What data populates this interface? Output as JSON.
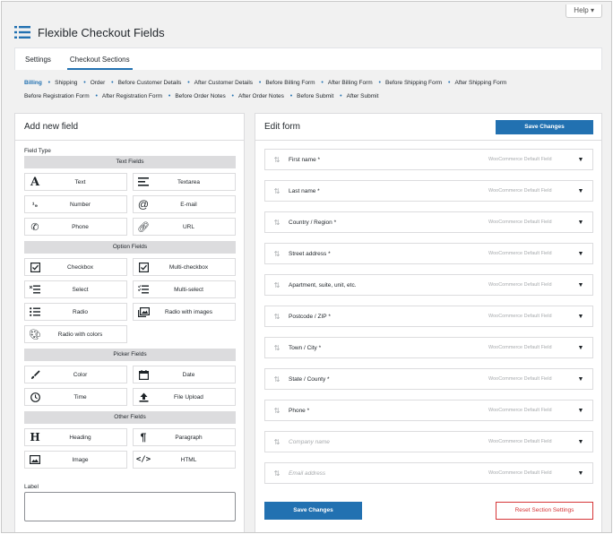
{
  "header": {
    "help_label": "Help ▾",
    "title": "Flexible Checkout Fields"
  },
  "tabs": [
    {
      "label": "Settings",
      "active": false
    },
    {
      "label": "Checkout Sections",
      "active": true
    }
  ],
  "sections": [
    "Billing",
    "Shipping",
    "Order",
    "Before Customer Details",
    "After Customer Details",
    "Before Billing Form",
    "After Billing Form",
    "Before Shipping Form",
    "After Shipping Form",
    "Before Registration Form",
    "After Registration Form",
    "Before Order Notes",
    "After Order Notes",
    "Before Submit",
    "After Submit"
  ],
  "add_field": {
    "title": "Add new field",
    "field_type_label": "Field Type",
    "groups": [
      {
        "name": "Text Fields",
        "fields": [
          {
            "label": "Text",
            "icon": "text-icon"
          },
          {
            "label": "Textarea",
            "icon": "textarea-icon"
          },
          {
            "label": "Number",
            "icon": "number-icon"
          },
          {
            "label": "E-mail",
            "icon": "email-icon"
          },
          {
            "label": "Phone",
            "icon": "phone-icon"
          },
          {
            "label": "URL",
            "icon": "link-icon"
          }
        ]
      },
      {
        "name": "Option Fields",
        "fields": [
          {
            "label": "Checkbox",
            "icon": "checkbox-icon"
          },
          {
            "label": "Multi-checkbox",
            "icon": "multi-checkbox-icon"
          },
          {
            "label": "Select",
            "icon": "select-icon"
          },
          {
            "label": "Multi-select",
            "icon": "multi-select-icon"
          },
          {
            "label": "Radio",
            "icon": "radio-icon"
          },
          {
            "label": "Radio with images",
            "icon": "image-radio-icon"
          },
          {
            "label": "Radio with colors",
            "icon": "palette-icon"
          }
        ]
      },
      {
        "name": "Picker Fields",
        "fields": [
          {
            "label": "Color",
            "icon": "brush-icon"
          },
          {
            "label": "Date",
            "icon": "calendar-icon"
          },
          {
            "label": "Time",
            "icon": "clock-icon"
          },
          {
            "label": "File Upload",
            "icon": "upload-icon"
          }
        ]
      },
      {
        "name": "Other Fields",
        "fields": [
          {
            "label": "Heading",
            "icon": "heading-icon"
          },
          {
            "label": "Paragraph",
            "icon": "paragraph-icon"
          },
          {
            "label": "Image",
            "icon": "image-icon"
          },
          {
            "label": "HTML",
            "icon": "code-icon"
          }
        ]
      }
    ],
    "label_field_label": "Label"
  },
  "edit_form": {
    "title": "Edit form",
    "save_label": "Save Changes",
    "reset_label": "Reset Section Settings",
    "fields": [
      {
        "name": "First name *",
        "note": "WooCommerce Default Field",
        "enabled": true
      },
      {
        "name": "Last name *",
        "note": "WooCommerce Default Field",
        "enabled": true
      },
      {
        "name": "Country / Region *",
        "note": "WooCommerce Default Field",
        "enabled": true
      },
      {
        "name": "Street address *",
        "note": "WooCommerce Default Field",
        "enabled": true
      },
      {
        "name": "Apartment, suite, unit, etc.",
        "note": "WooCommerce Default Field",
        "enabled": true
      },
      {
        "name": "Postcode / ZIP *",
        "note": "WooCommerce Default Field",
        "enabled": true
      },
      {
        "name": "Town / City *",
        "note": "WooCommerce Default Field",
        "enabled": true
      },
      {
        "name": "State / County *",
        "note": "WooCommerce Default Field",
        "enabled": true
      },
      {
        "name": "Phone *",
        "note": "WooCommerce Default Field",
        "enabled": true
      },
      {
        "name": "Company name",
        "note": "WooCommerce Default Field",
        "enabled": false
      },
      {
        "name": "Email address",
        "note": "WooCommerce Default Field",
        "enabled": false
      }
    ]
  },
  "colors": {
    "accent": "#2271b1",
    "danger": "#d63638"
  }
}
